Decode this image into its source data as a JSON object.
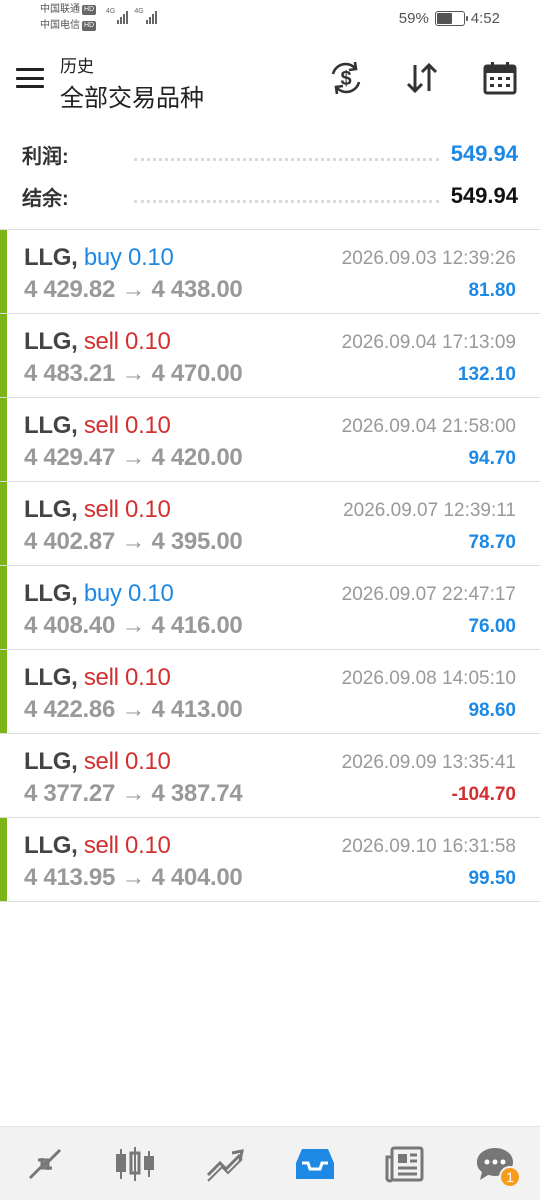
{
  "status_bar": {
    "carrier1": "中国联通",
    "carrier2": "中国电信",
    "hd": "HD",
    "network": "4G",
    "battery_percent": "59%",
    "battery_level": 0.59,
    "time": "4:52"
  },
  "header": {
    "title_small": "历史",
    "title_big": "全部交易品种",
    "icons": [
      "menu-icon",
      "exchange-dollar-icon",
      "sort-icon",
      "calendar-icon"
    ]
  },
  "summary": {
    "profit_label": "利润:",
    "profit_value": "549.94",
    "balance_label": "结余:",
    "balance_value": "549.94"
  },
  "trades": [
    {
      "symbol": "LLG,",
      "direction": "buy",
      "volume": "0.10",
      "prices": "4 429.82 → 4 438.00",
      "time": "2026.09.03 12:39:26",
      "profit": "81.80",
      "bar": true
    },
    {
      "symbol": "LLG,",
      "direction": "sell",
      "volume": "0.10",
      "prices": "4 483.21 → 4 470.00",
      "time": "2026.09.04 17:13:09",
      "profit": "132.10",
      "bar": true
    },
    {
      "symbol": "LLG,",
      "direction": "sell",
      "volume": "0.10",
      "prices": "4 429.47 → 4 420.00",
      "time": "2026.09.04 21:58:00",
      "profit": "94.70",
      "bar": true
    },
    {
      "symbol": "LLG,",
      "direction": "sell",
      "volume": "0.10",
      "prices": "4 402.87 → 4 395.00",
      "time": "2026.09.07 12:39:11",
      "profit": "78.70",
      "bar": true
    },
    {
      "symbol": "LLG,",
      "direction": "buy",
      "volume": "0.10",
      "prices": "4 408.40 → 4 416.00",
      "time": "2026.09.07 22:47:17",
      "profit": "76.00",
      "bar": true
    },
    {
      "symbol": "LLG,",
      "direction": "sell",
      "volume": "0.10",
      "prices": "4 422.86 → 4 413.00",
      "time": "2026.09.08 14:05:10",
      "profit": "98.60",
      "bar": true
    },
    {
      "symbol": "LLG,",
      "direction": "sell",
      "volume": "0.10",
      "prices": "4 377.27 → 4 387.74",
      "time": "2026.09.09 13:35:41",
      "profit": "-104.70",
      "bar": false
    },
    {
      "symbol": "LLG,",
      "direction": "sell",
      "volume": "0.10",
      "prices": "4 413.95 → 4 404.00",
      "time": "2026.09.10 16:31:58",
      "profit": "99.50",
      "bar": true
    }
  ],
  "bottom_nav": {
    "items": [
      "quotes-icon",
      "chart-icon",
      "trade-icon",
      "history-icon",
      "news-icon",
      "messages-icon"
    ],
    "active": "history-icon",
    "badge": "1"
  },
  "colors": {
    "accent_blue": "#1e88e5",
    "sell_red": "#d32f2f",
    "profit_bar_green": "#7cb518",
    "badge_orange": "#f59c1a"
  }
}
